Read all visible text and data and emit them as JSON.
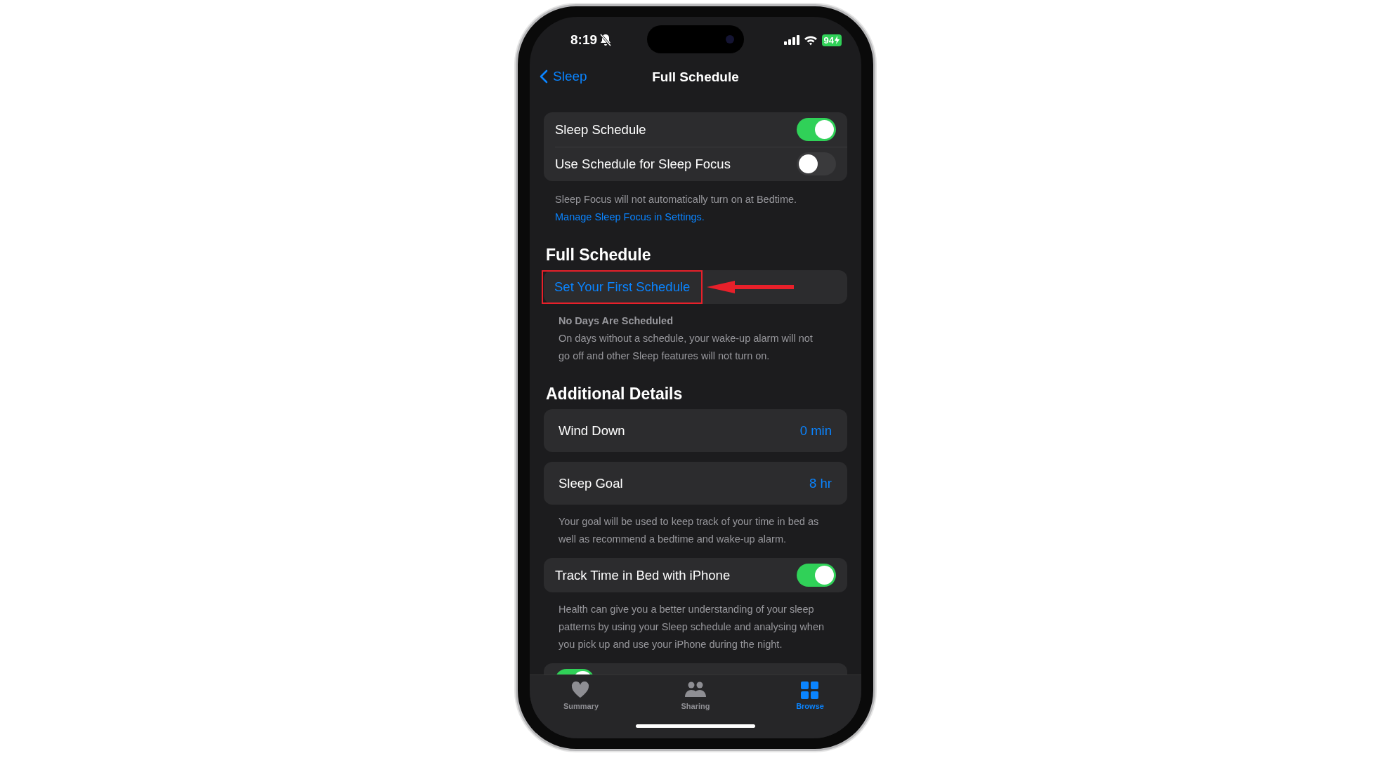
{
  "status_bar": {
    "time": "8:19",
    "battery": "94"
  },
  "nav": {
    "back": "Sleep",
    "title": "Full Schedule"
  },
  "sections": [
    {
      "rows": [
        {
          "kind": "toggle",
          "label": "Sleep Schedule",
          "on": true
        },
        {
          "kind": "toggle",
          "label": "Use Schedule for Sleep Focus",
          "on": false
        }
      ],
      "footer": [
        {
          "kind": "note",
          "text": "Sleep Focus will not automatically turn on at Bedtime."
        },
        {
          "kind": "link",
          "text": "Manage Sleep Focus in Settings."
        }
      ]
    },
    {
      "header": "Full Schedule",
      "rows": [
        {
          "kind": "action",
          "label": "Set Your First Schedule",
          "annotated": true
        }
      ],
      "footer": [
        {
          "kind": "title",
          "text": "No Days Are Scheduled"
        },
        {
          "kind": "note",
          "text": "On days without a schedule, your wake-up alarm will not go off and other Sleep features will not turn on."
        }
      ]
    },
    {
      "header": "Additional Details",
      "rows": [
        {
          "kind": "value",
          "label": "Wind Down",
          "value": "0 min"
        }
      ]
    },
    {
      "rows": [
        {
          "kind": "value",
          "label": "Sleep Goal",
          "value": "8 hr"
        }
      ],
      "footer": [
        {
          "kind": "note",
          "text": "Your goal will be used to keep track of your time in bed as well as recommend a bedtime and wake-up alarm."
        }
      ]
    },
    {
      "rows": [
        {
          "kind": "toggle",
          "label": "Track Time in Bed with iPhone",
          "on": true
        }
      ],
      "footer": [
        {
          "kind": "note",
          "text": "Health can give you a better understanding of your sleep patterns by using your Sleep schedule and analysing when you pick up and use your iPhone during the night."
        }
      ]
    },
    {
      "rows": [
        {
          "kind": "toggle",
          "on": true
        }
      ]
    }
  ],
  "tab_bar": [
    {
      "label": "Summary",
      "kind": "heart",
      "selected": false
    },
    {
      "label": "Sharing",
      "kind": "people",
      "selected": false
    },
    {
      "label": "Browse",
      "kind": "grid",
      "selected": true
    }
  ]
}
